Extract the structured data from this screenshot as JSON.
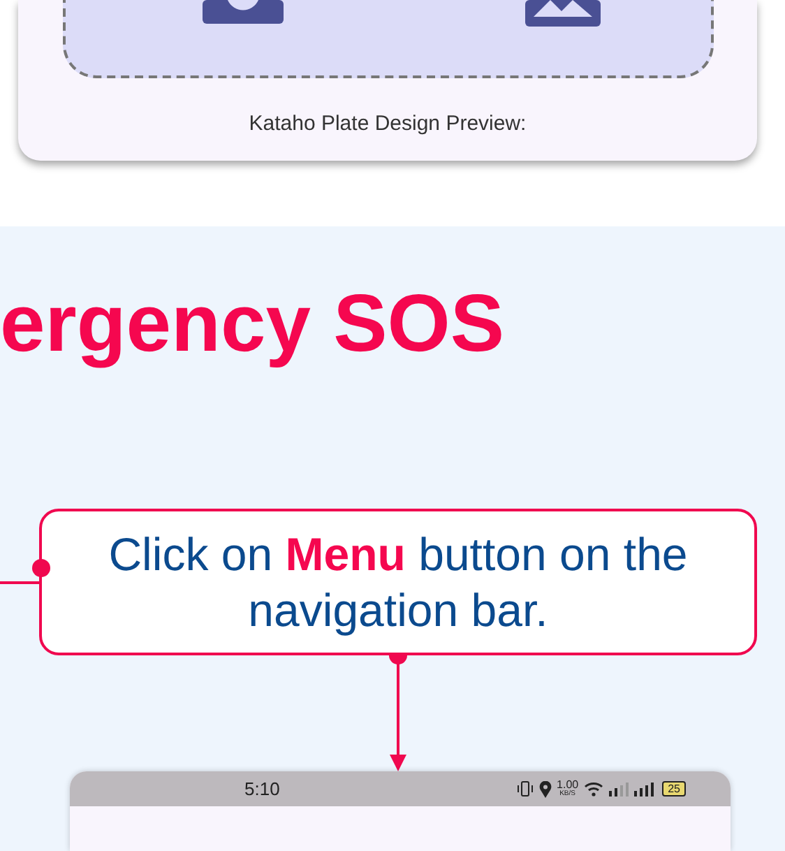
{
  "preview_card": {
    "caption": "Kataho Plate Design Preview:"
  },
  "heading": "ergency SOS",
  "callout": {
    "text": "Click on **Menu** button on the navigation bar."
  },
  "phone": {
    "status_bar": {
      "time": "5:10",
      "speed_value": "1.00",
      "speed_unit": "KB/S",
      "battery": "25"
    }
  }
}
